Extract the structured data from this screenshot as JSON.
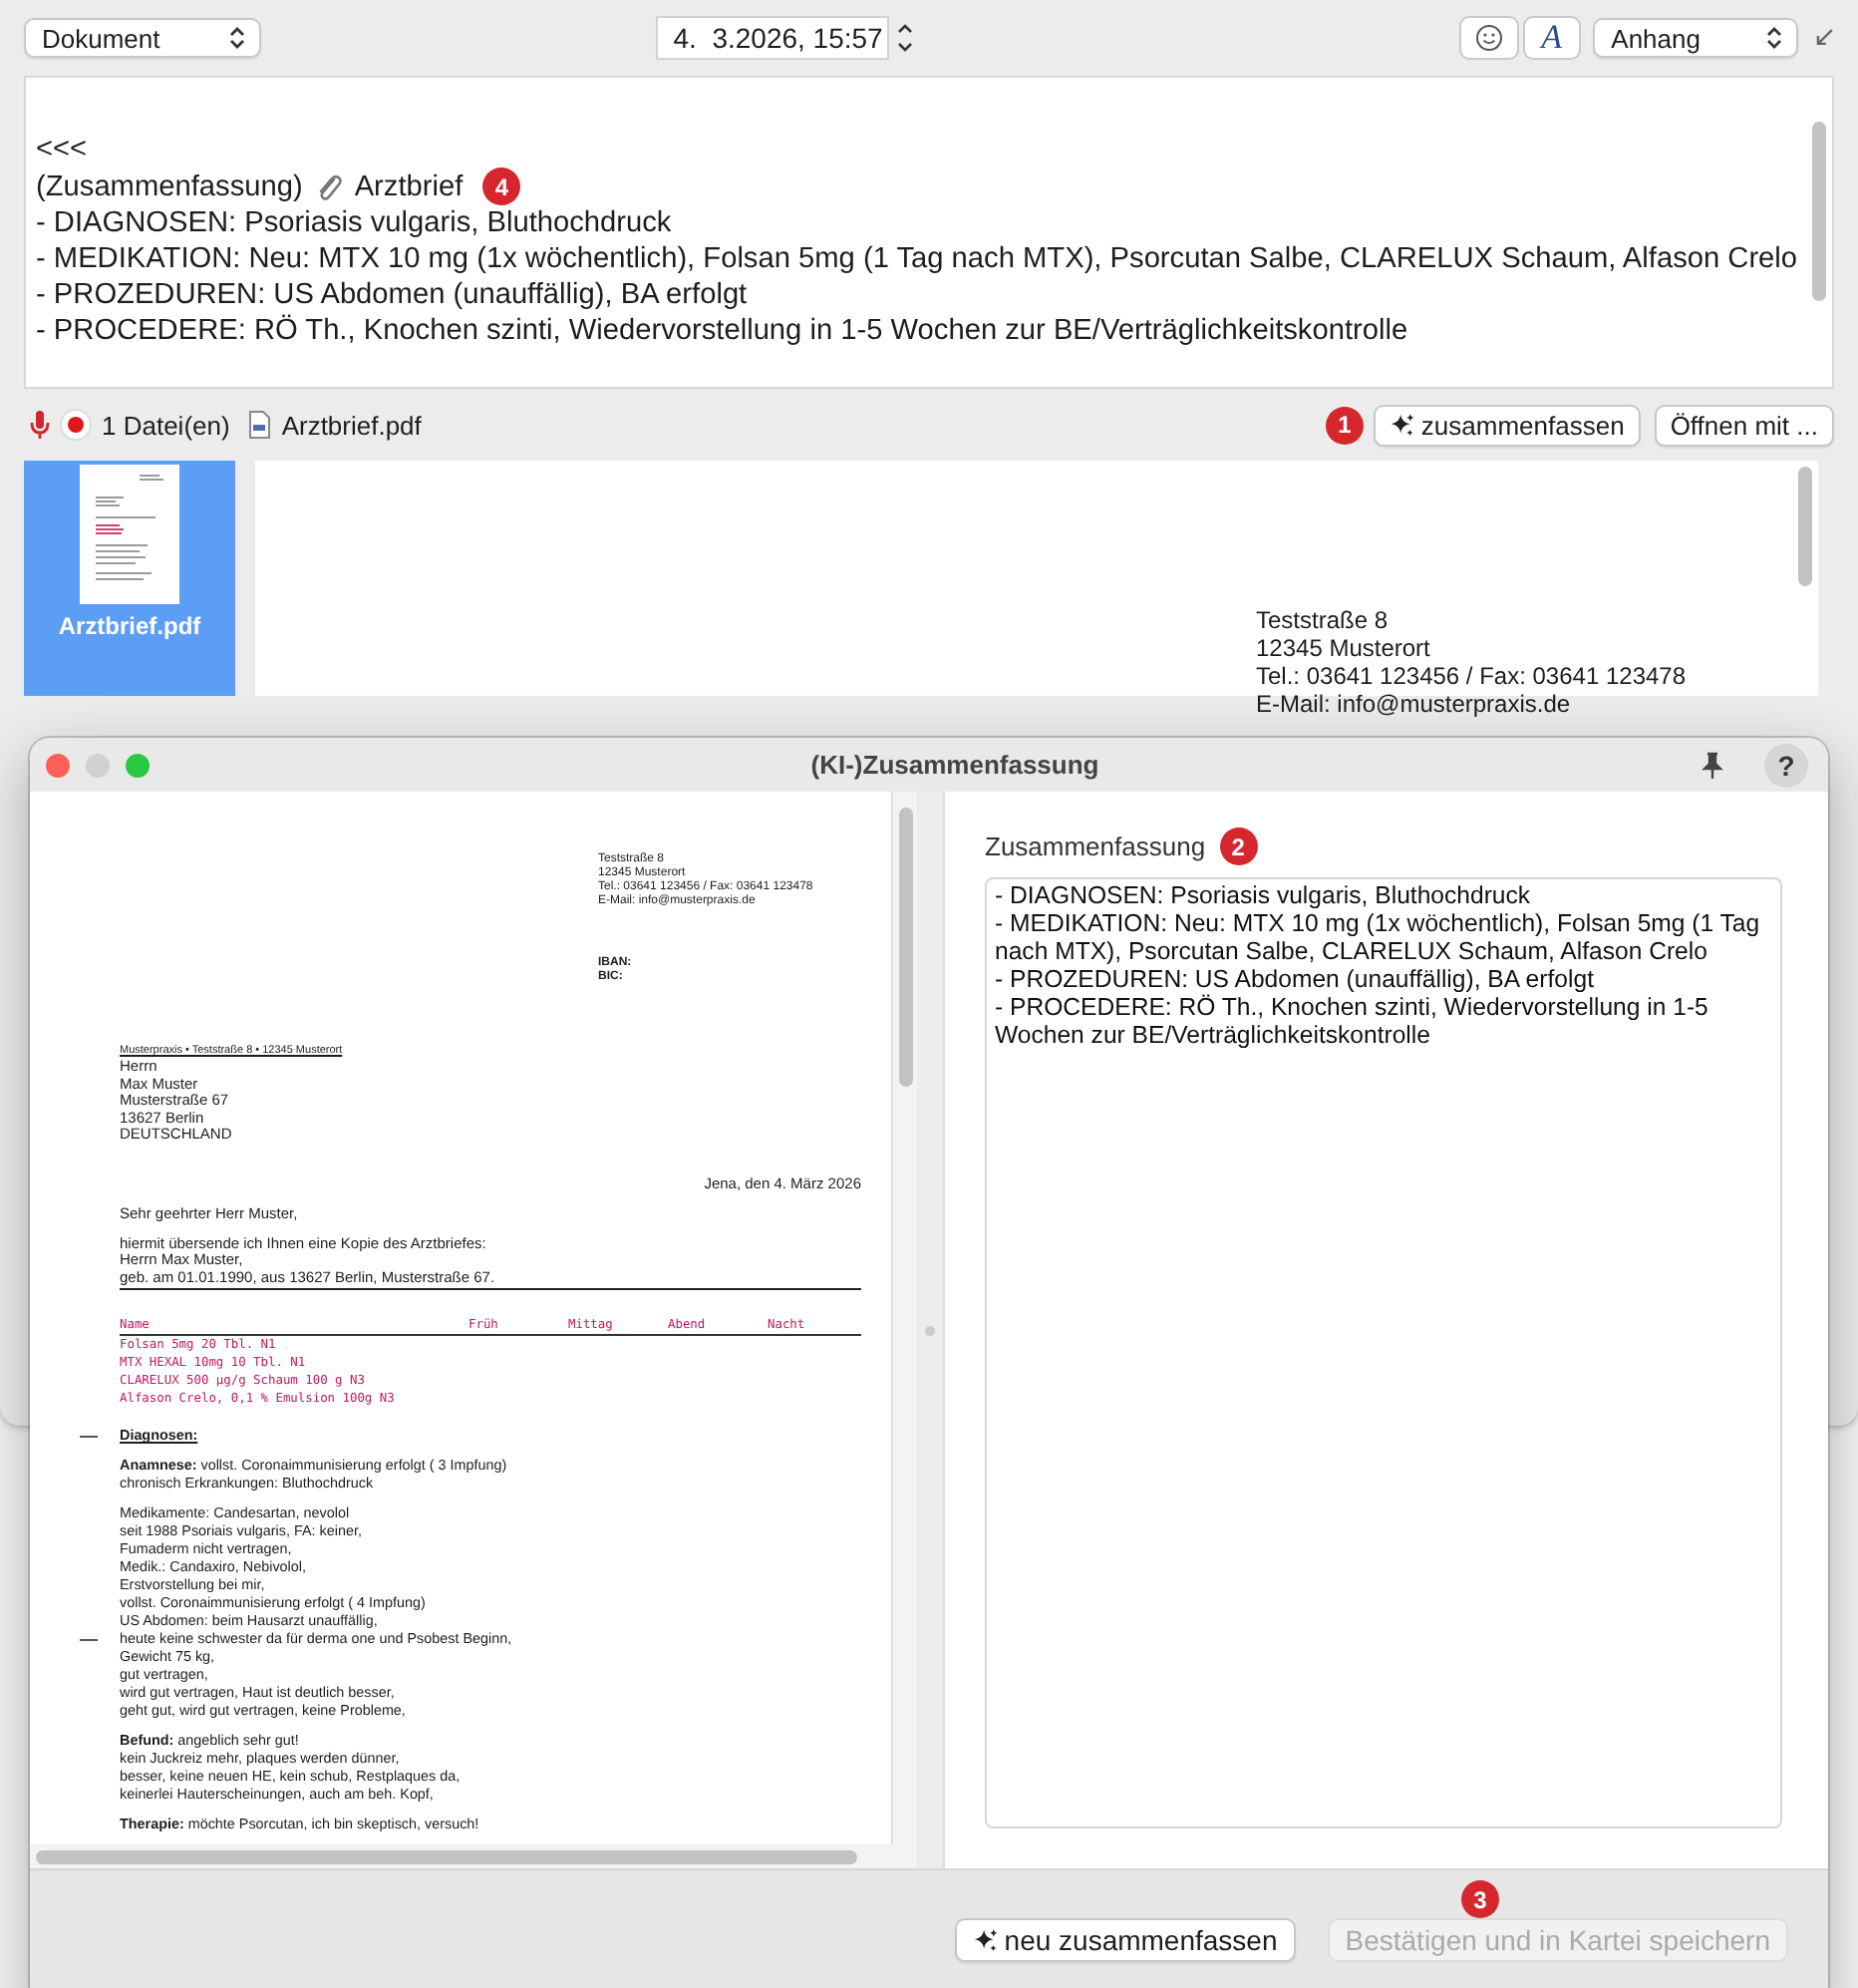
{
  "toolbar": {
    "document_select": "Dokument",
    "datetime": "4.  3.2026, 15:57",
    "font_button": "A",
    "attachment_select": "Anhang"
  },
  "note": {
    "marker": "<<<",
    "heading_prefix": "(Zusammenfassung)",
    "heading_attachment": "Arztbrief",
    "badge": "4",
    "lines": [
      "- DIAGNOSEN: Psoriasis vulgaris, Bluthochdruck",
      "- MEDIKATION: Neu: MTX 10 mg (1x wöchentlich), Folsan 5mg (1 Tag nach MTX), Psorcutan Salbe, CLARELUX Schaum, Alfason Crelo",
      "- PROZEDUREN: US Abdomen (unauffällig), BA erfolgt",
      "- PROCEDERE: RÖ Th., Knochen szinti, Wiedervorstellung in 1-5 Wochen zur BE/Verträglichkeitskontrolle"
    ]
  },
  "attachments": {
    "count": "1 Datei(en)",
    "file": "Arztbrief.pdf",
    "badge": "1",
    "summarize_button": "zusammenfassen",
    "open_button": "Öffnen mit ..."
  },
  "thumbnail": {
    "label": "Arztbrief.pdf",
    "selected": true
  },
  "preview": {
    "sender_lines": [
      "Teststraße 8",
      "12345 Musterort",
      "Tel.: 03641 123456 / Fax: 03641 123478",
      "E-Mail: info@musterpraxis.de"
    ]
  },
  "dialog": {
    "title": "(KI-)Zusammenfassung",
    "help_button": "?",
    "pdf": {
      "sender_lines": [
        "Teststraße 8",
        "12345 Musterort",
        "Tel.: 03641 123456 / Fax: 03641 123478",
        "E-Mail: info@musterpraxis.de"
      ],
      "bank_lines": [
        "IBAN:",
        "BIC:"
      ],
      "return_address": "Musterpraxis • Teststraße 8 • 12345 Musterort",
      "recipient_lines": [
        "Herrn",
        "Max Muster",
        "Musterstraße 67",
        "13627 Berlin",
        "DEUTSCHLAND"
      ],
      "date": "Jena, den 4. März 2026",
      "salutation": "Sehr geehrter Herr Muster,",
      "intro_lines": [
        "hiermit übersende ich Ihnen eine Kopie des Arztbriefes:",
        "Herrn Max Muster,",
        "geb. am 01.01.1990, aus 13627 Berlin, Musterstraße 67."
      ],
      "med_columns": [
        "Name",
        "Früh",
        "Mittag",
        "Abend",
        "Nacht"
      ],
      "med_rows": [
        "Folsan 5mg 20 Tbl. N1",
        "MTX HEXAL 10mg 10 Tbl. N1",
        "CLARELUX  500 µg/g Schaum 100 g N3",
        "Alfason Crelo, 0,1 % Emulsion 100g N3"
      ],
      "heading": "Diagnosen:",
      "heading_margin_mark": true,
      "paragraphs": [
        [
          {
            "text": "**Anamnese:** vollst. Coronaimmunisierung erfolgt ( 3 Impfung)",
            "margin_mark": false
          },
          {
            "text": "chronisch Erkrankungen: Bluthochdruck",
            "margin_mark": false
          }
        ],
        [
          {
            "text": "Medikamente: Candesartan, nevolol",
            "margin_mark": false
          },
          {
            "text": "seit 1988 Psoriais vulgaris, FA: keiner,",
            "margin_mark": false
          },
          {
            "text": "Fumaderm nicht vertragen,",
            "margin_mark": false
          },
          {
            "text": "Medik.: Candaxiro, Nebivolol,",
            "margin_mark": false
          },
          {
            "text": "Erstvorstellung bei mir,",
            "margin_mark": false
          },
          {
            "text": "vollst. Coronaimmunisierung erfolgt ( 4 Impfung)",
            "margin_mark": false
          },
          {
            "text": "US Abdomen: beim Hausarzt unauffällig,",
            "margin_mark": false
          },
          {
            "text": "heute keine schwester da für derma one und Psobest Beginn,",
            "margin_mark": true
          },
          {
            "text": "Gewicht 75 kg,",
            "margin_mark": false
          },
          {
            "text": "gut vertragen,",
            "margin_mark": false
          },
          {
            "text": "wird gut vertragen, Haut ist deutlich besser,",
            "margin_mark": false
          },
          {
            "text": "geht gut, wird gut vertragen, keine Probleme,",
            "margin_mark": false
          }
        ],
        [
          {
            "text": "**Befund:** angeblich sehr gut!",
            "margin_mark": false
          },
          {
            "text": "kein Juckreiz mehr, plaques werden dünner,",
            "margin_mark": false
          },
          {
            "text": "besser, keine neuen HE, kein schub, Restplaques da,",
            "margin_mark": false
          },
          {
            "text": "keinerlei Hauterscheinungen, auch am beh. Kopf,",
            "margin_mark": false
          }
        ],
        [
          {
            "text": "**Therapie:** möchte Psorcutan, ich bin skeptisch, versuch!",
            "margin_mark": false
          }
        ]
      ]
    },
    "summary_label": "Zusammenfassung",
    "summary_badge": "2",
    "summary_text": "- DIAGNOSEN: Psoriasis vulgaris, Bluthochdruck\n- MEDIKATION: Neu: MTX 10 mg (1x wöchentlich), Folsan 5mg (1 Tag nach MTX), Psorcutan Salbe, CLARELUX Schaum, Alfason Crelo\n- PROZEDUREN: US Abdomen (unauffällig), BA erfolgt\n- PROCEDERE: RÖ Th., Knochen szinti, Wiedervorstellung in 1-5 Wochen zur BE/Verträglichkeitskontrolle",
    "footer_badge": "3",
    "buttons": [
      {
        "label": "neu zusammenfassen",
        "kind": "sparkle",
        "disabled": false
      },
      {
        "label": "Bestätigen und in Kartei speichern",
        "kind": "plain",
        "disabled": true
      }
    ]
  }
}
